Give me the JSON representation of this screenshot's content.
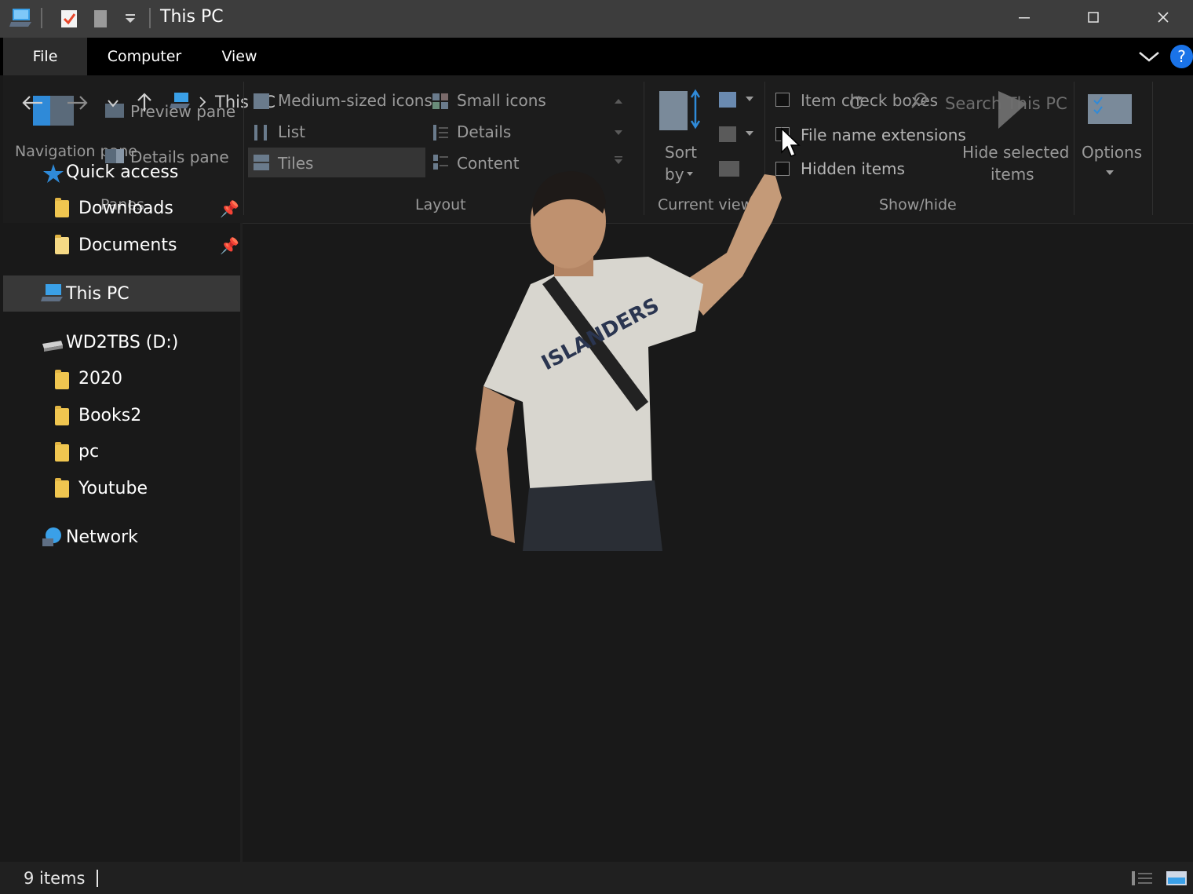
{
  "window": {
    "title": "This PC"
  },
  "tabs": [
    {
      "label": "File"
    },
    {
      "label": "Computer"
    },
    {
      "label": "View"
    }
  ],
  "ribbon": {
    "panes": {
      "navigation_pane": "Navigation pane",
      "preview_pane": "Preview pane",
      "details_pane": "Details pane",
      "group_label": "Panes"
    },
    "layout": {
      "items": [
        "Medium-sized icons",
        "Small icons",
        "List",
        "Details",
        "Tiles",
        "Content"
      ],
      "group_label": "Layout",
      "selected": "Tiles"
    },
    "current_view": {
      "sort_by_1": "Sort",
      "sort_by_2": "by",
      "group_label": "Current view"
    },
    "show_hide": {
      "item_check_boxes": "Item check boxes",
      "file_name_extensions": "File name extensions",
      "hidden_items": "Hidden items",
      "hide_selected_1": "Hide selected",
      "hide_selected_2": "items",
      "group_label": "Show/hide"
    },
    "options": {
      "label": "Options"
    }
  },
  "address": {
    "crumb": "This PC"
  },
  "search": {
    "placeholder": "Search This PC"
  },
  "nav": {
    "quick_access": "Quick access",
    "items": [
      {
        "label": "Downloads",
        "pinned": true
      },
      {
        "label": "Documents",
        "pinned": true
      },
      {
        "label": "This PC"
      },
      {
        "label": "WD2TBS (D:)"
      },
      {
        "label": "2020"
      },
      {
        "label": "Books2"
      },
      {
        "label": "pc"
      },
      {
        "label": "Youtube"
      },
      {
        "label": "Network"
      }
    ]
  },
  "status": {
    "items_count": "9 items"
  },
  "colors": {
    "titlebar": "#3d3d3d",
    "tabs_bg": "#000000",
    "ribbon_bg": "#1c1c1c",
    "content_bg": "#191919",
    "selected_nav": "#383838",
    "help_blue": "#1a73e8"
  }
}
